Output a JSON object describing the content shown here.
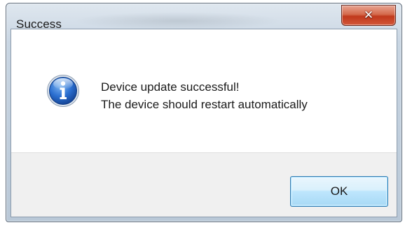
{
  "dialog": {
    "title": "Success",
    "close_icon": "close-x-icon",
    "icon": "info-icon",
    "message_lines": [
      "Device update successful!",
      "The device should restart automatically"
    ],
    "ok_label": "OK"
  },
  "colors": {
    "close_button": "#c74a2e",
    "ok_button_border": "#3c7fb1",
    "info_icon_blue": "#1b5ab7",
    "footer_bg": "#f0f0f0"
  }
}
